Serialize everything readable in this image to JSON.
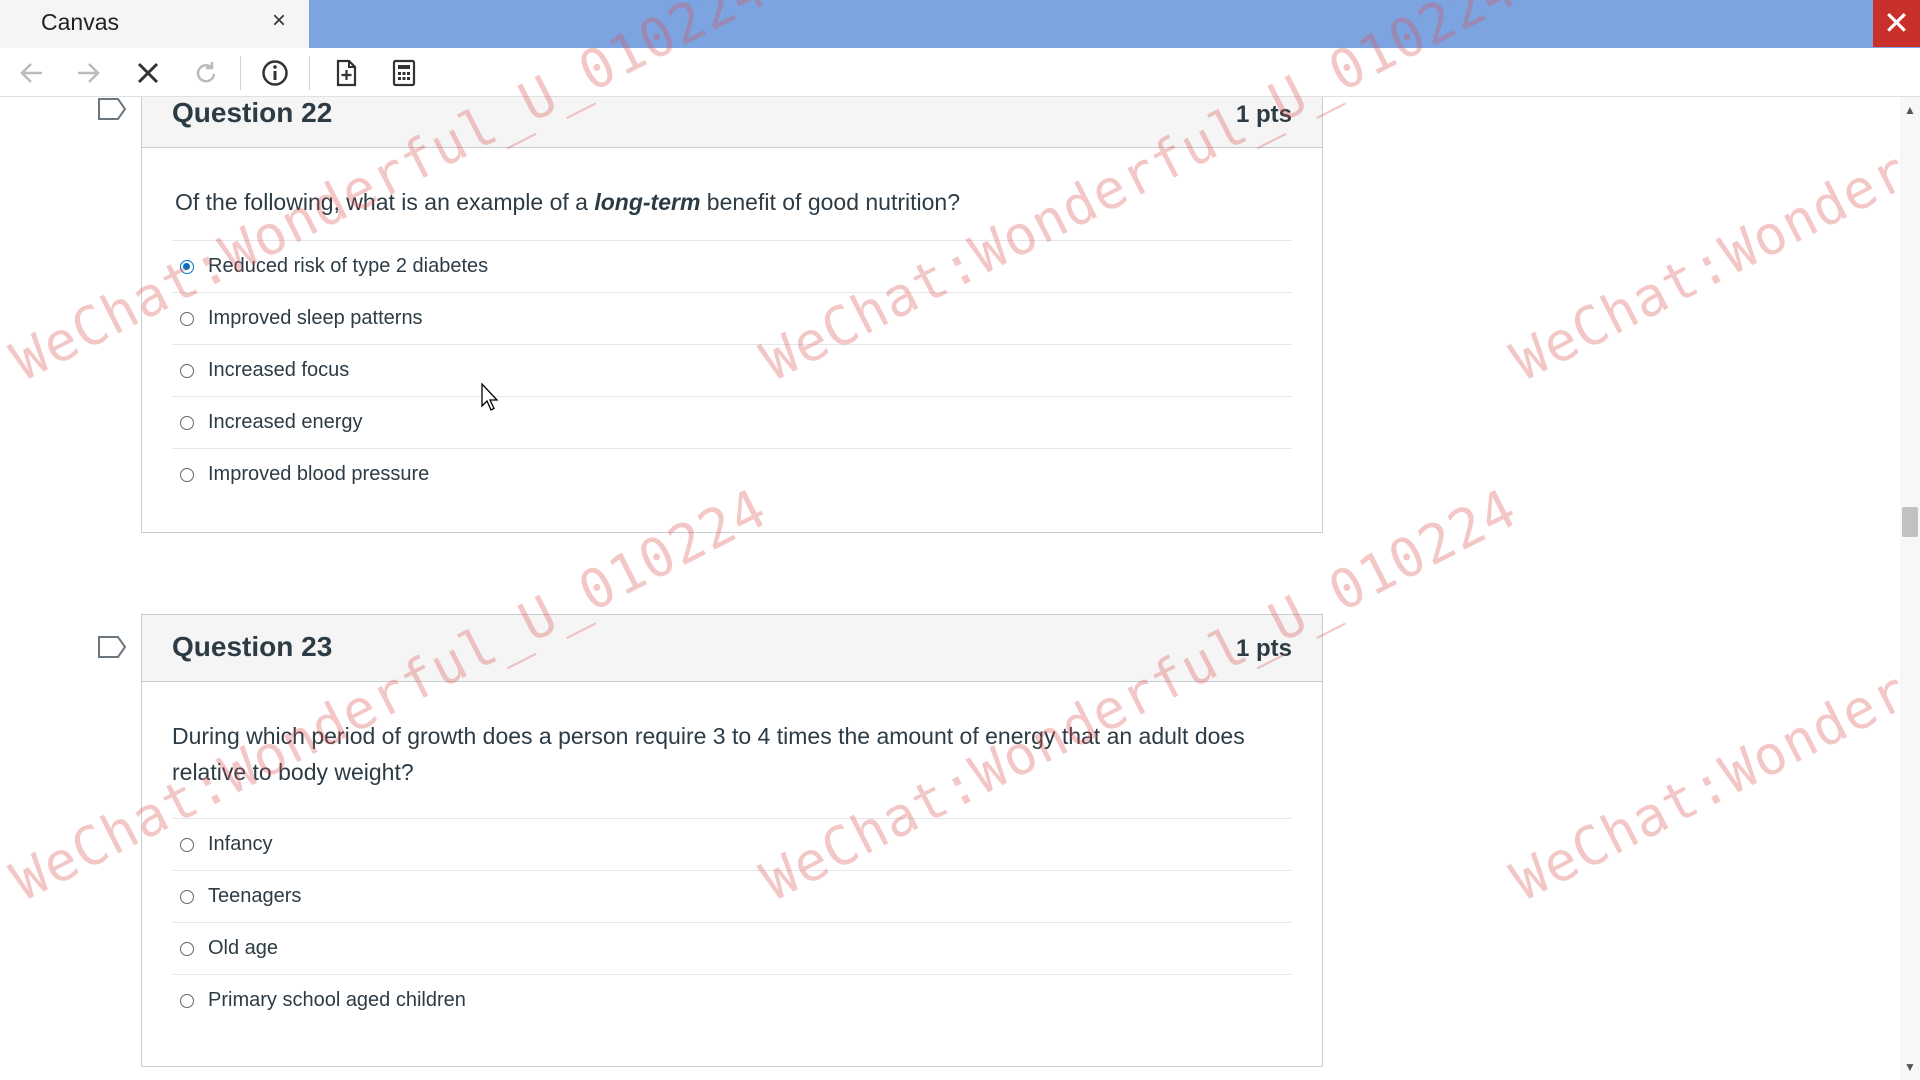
{
  "window": {
    "tab_title": "Canvas",
    "tab_close": "×",
    "close_button": "✕"
  },
  "toolbar": {
    "icons": [
      "back-arrow-icon",
      "forward-arrow-icon",
      "stop-icon",
      "reload-icon",
      "info-icon",
      "add-page-icon",
      "calculator-icon"
    ]
  },
  "questions": [
    {
      "title": "Question 22",
      "points": "1 pts",
      "text_before": "Of the following, what is an example of a ",
      "text_emphasis": "long-term",
      "text_after": " benefit of good nutrition?",
      "answers": [
        {
          "label": "Reduced risk of type 2 diabetes",
          "selected": true
        },
        {
          "label": "Improved sleep patterns",
          "selected": false
        },
        {
          "label": "Increased focus",
          "selected": false
        },
        {
          "label": "Increased energy",
          "selected": false
        },
        {
          "label": "Improved blood pressure",
          "selected": false
        }
      ]
    },
    {
      "title": "Question 23",
      "points": "1 pts",
      "text": "During which period of growth does a person require 3 to 4 times the amount of energy that an adult does relative to body weight?",
      "answers": [
        {
          "label": "Infancy",
          "selected": false
        },
        {
          "label": "Teenagers",
          "selected": false
        },
        {
          "label": "Old age",
          "selected": false
        },
        {
          "label": "Primary school aged children",
          "selected": false
        }
      ]
    }
  ],
  "watermark": {
    "text": "WeChat:Wonderful_U_010224",
    "color": "#dc5050"
  },
  "colors": {
    "titlebar": "#7ba4e0",
    "close_button": "#c9302c",
    "radio_selected": "#0770c2"
  }
}
